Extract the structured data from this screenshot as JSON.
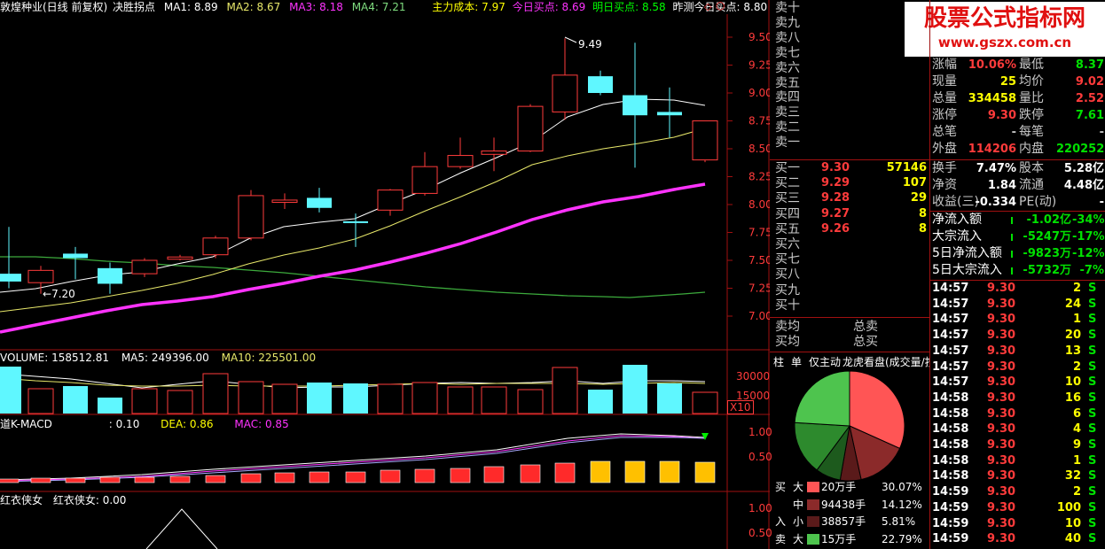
{
  "header": {
    "title": "敦煌种业(日线 前复权)",
    "indicator": "决胜拐点",
    "ma1": "MA1: 8.89",
    "ma2": "MA2: 8.67",
    "ma3": "MA3: 8.18",
    "ma4": "MA4: 7.21",
    "cost": "主力成本: 7.97",
    "buy_today": "今日买点: 8.69",
    "buy_tomorrow": "明日买点: 8.58",
    "predict": "昨测今日买点: 8.80",
    "corner_icon": "diamond-icon"
  },
  "watermark": {
    "text": "股票公式指标网",
    "url": "www.gszx.com.cn"
  },
  "colors": {
    "up": "#ff3b3b",
    "down": "#5ff7ff",
    "ma1": "#ffffff",
    "ma2": "#e8e86a",
    "ma3": "#ff33ff",
    "ma4": "#3caa3c",
    "bg": "#000000"
  },
  "price_axis": [
    "9.50",
    "9.25",
    "9.00",
    "8.75",
    "8.50",
    "8.25",
    "8.00",
    "7.75",
    "7.50",
    "7.25",
    "7.00"
  ],
  "price_annotations": {
    "high": "9.49",
    "low": "7.20"
  },
  "volume": {
    "header": "VOLUME: 158512.81",
    "ma5": "MA5: 249396.00",
    "ma10": "MA10: 225501.00",
    "axis": [
      "30000",
      "15000"
    ],
    "unit": "X10"
  },
  "macd": {
    "header": "道K-MACD",
    "val": ": 0.10",
    "dea": "DEA: 0.86",
    "mac": "MAC: 0.85",
    "axis": [
      "1.00",
      "0.50"
    ]
  },
  "bottom_indicator": {
    "name": "红衣侠女",
    "label": "红衣侠女: 0.00",
    "axis": [
      "1.00",
      "0.50"
    ]
  },
  "orderbook": {
    "sells": [
      "卖十",
      "卖九",
      "卖八",
      "卖七",
      "卖六",
      "卖五",
      "卖四",
      "卖三",
      "卖二",
      "卖一"
    ],
    "buys": [
      {
        "label": "买一",
        "price": "9.30",
        "vol": "57146"
      },
      {
        "label": "买二",
        "price": "9.29",
        "vol": "107"
      },
      {
        "label": "买三",
        "price": "9.28",
        "vol": "29"
      },
      {
        "label": "买四",
        "price": "9.27",
        "vol": "8"
      },
      {
        "label": "买五",
        "price": "9.26",
        "vol": "8"
      },
      {
        "label": "买六",
        "price": "",
        "vol": ""
      },
      {
        "label": "买七",
        "price": "",
        "vol": ""
      },
      {
        "label": "买八",
        "price": "",
        "vol": ""
      },
      {
        "label": "买九",
        "price": "",
        "vol": ""
      },
      {
        "label": "买十",
        "price": "",
        "vol": ""
      }
    ],
    "sell_avg": "卖均",
    "buy_avg": "买均",
    "total_sell": "总卖",
    "total_buy": "总买"
  },
  "stats": [
    {
      "l1": "涨幅",
      "v1": "10.06%",
      "c1": "red",
      "l2": "最低",
      "v2": "8.37",
      "c2": "green"
    },
    {
      "l1": "现量",
      "v1": "25",
      "c1": "yellow",
      "l2": "均价",
      "v2": "9.02",
      "c2": "red"
    },
    {
      "l1": "总量",
      "v1": "334458",
      "c1": "yellow",
      "l2": "量比",
      "v2": "2.52",
      "c2": "red"
    },
    {
      "l1": "涨停",
      "v1": "9.30",
      "c1": "red",
      "l2": "跌停",
      "v2": "7.61",
      "c2": "green"
    },
    {
      "l1": "总笔",
      "v1": "-",
      "c1": "gray",
      "l2": "每笔",
      "v2": "-",
      "c2": "gray"
    },
    {
      "l1": "外盘",
      "v1": "114206",
      "c1": "red",
      "l2": "内盘",
      "v2": "220252",
      "c2": "green"
    }
  ],
  "stats2": [
    {
      "l1": "换手",
      "v1": "7.47%",
      "c1": "white",
      "l2": "股本",
      "v2": "5.28亿",
      "c2": "white"
    },
    {
      "l1": "净资",
      "v1": "1.84",
      "c1": "white",
      "l2": "流通",
      "v2": "4.48亿",
      "c2": "white"
    },
    {
      "l1": "收益(三)",
      "v1": "-0.334",
      "c1": "white",
      "l2": "PE(动)",
      "v2": "-",
      "c2": "white"
    }
  ],
  "flows": [
    {
      "label": "净流入额",
      "val": "-1.02亿",
      "pct": "-34%"
    },
    {
      "label": "大宗流入",
      "val": "-5247万",
      "pct": "-17%"
    },
    {
      "label": "5日净流入额",
      "val": "-9823万",
      "pct": "-12%"
    },
    {
      "label": "5日大宗流入",
      "val": "-5732万",
      "pct": "-7%"
    }
  ],
  "ticks": [
    {
      "t": "14:57",
      "p": "9.30",
      "v": "2",
      "s": "S"
    },
    {
      "t": "14:57",
      "p": "9.30",
      "v": "24",
      "s": "S"
    },
    {
      "t": "14:57",
      "p": "9.30",
      "v": "1",
      "s": "S"
    },
    {
      "t": "14:57",
      "p": "9.30",
      "v": "20",
      "s": "S"
    },
    {
      "t": "14:57",
      "p": "9.30",
      "v": "13",
      "s": "S"
    },
    {
      "t": "14:57",
      "p": "9.30",
      "v": "2",
      "s": "S"
    },
    {
      "t": "14:57",
      "p": "9.30",
      "v": "10",
      "s": "S"
    },
    {
      "t": "14:58",
      "p": "9.30",
      "v": "16",
      "s": "S"
    },
    {
      "t": "14:58",
      "p": "9.30",
      "v": "6",
      "s": "S"
    },
    {
      "t": "14:58",
      "p": "9.30",
      "v": "4",
      "s": "S"
    },
    {
      "t": "14:58",
      "p": "9.30",
      "v": "9",
      "s": "S"
    },
    {
      "t": "14:58",
      "p": "9.30",
      "v": "1",
      "s": "S"
    },
    {
      "t": "14:58",
      "p": "9.30",
      "v": "32",
      "s": "S"
    },
    {
      "t": "14:59",
      "p": "9.30",
      "v": "2",
      "s": "S"
    },
    {
      "t": "14:59",
      "p": "9.30",
      "v": "100",
      "s": "S"
    },
    {
      "t": "14:59",
      "p": "9.30",
      "v": "10",
      "s": "S"
    },
    {
      "t": "14:59",
      "p": "9.30",
      "v": "40",
      "s": "S"
    }
  ],
  "tabs": [
    "柱",
    "单",
    "仅主动",
    "龙虎看盘(成交量/按"
  ],
  "pie_legend": [
    {
      "side": "买",
      "size": "大",
      "color": "#ff5555",
      "vol": "20万手",
      "pct": "30.07%"
    },
    {
      "side": "",
      "size": "中",
      "color": "#8b2a2a",
      "vol": "94438手",
      "pct": "14.12%"
    },
    {
      "side": "入",
      "size": "小",
      "color": "#5a1a1a",
      "vol": "38857手",
      "pct": "5.81%"
    },
    {
      "side": "卖",
      "size": "大",
      "color": "#4ec44e",
      "vol": "15万手",
      "pct": "22.79%"
    }
  ],
  "pie_slices_pct": [
    30.07,
    14.12,
    5.81,
    7.0,
    15.0,
    22.79
  ]
}
